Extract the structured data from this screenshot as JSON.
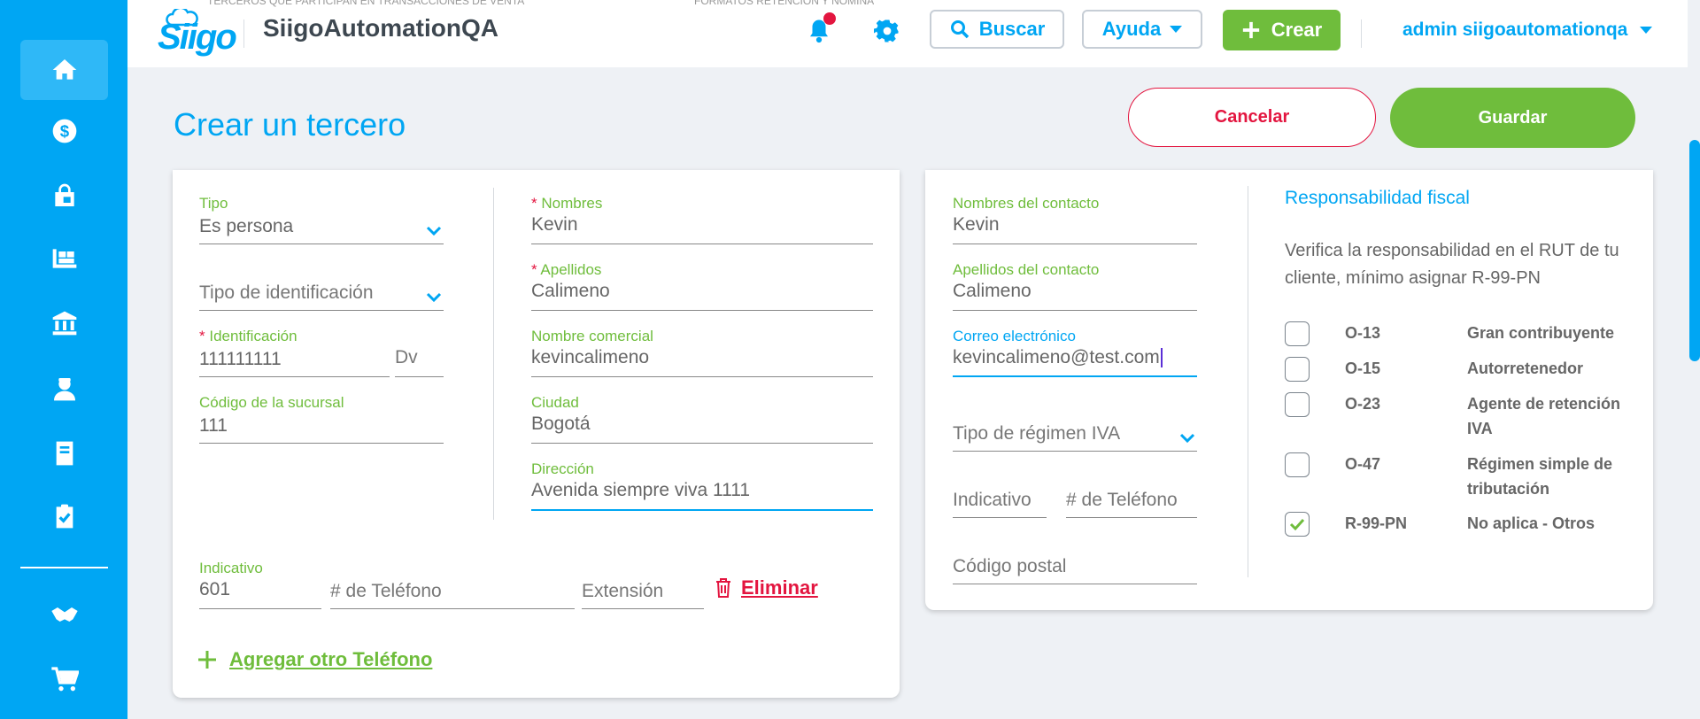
{
  "header": {
    "company_name": "SiigoAutomationQA",
    "logo_text": "Siigo",
    "search_label": "Buscar",
    "help_label": "Ayuda",
    "create_label": "Crear",
    "user_label": "admin siigoautomationqa",
    "ghost_text_1": "TERCEROS QUE PARTICIPAN EN TRANSACCIONES DE VENTA",
    "ghost_text_2": "FORMATOS RETENCIÓN Y NÓMINA"
  },
  "sidebar": {
    "items": [
      "home-icon",
      "dollar-icon",
      "shopping-bag-icon",
      "inventory-icon",
      "bank-icon",
      "employee-icon",
      "book-icon",
      "clipboard-check-icon",
      "handshake-icon",
      "cart-icon"
    ]
  },
  "page": {
    "title": "Crear un tercero",
    "cancel_label": "Cancelar",
    "save_label": "Guardar"
  },
  "left_card": {
    "tipo": {
      "label": "Tipo",
      "value": "Es persona"
    },
    "tipo_identificacion": {
      "placeholder": "Tipo de identificación"
    },
    "identificacion": {
      "required_mark": "*",
      "label": "Identificación",
      "value": "111111111"
    },
    "dv": {
      "placeholder": "Dv"
    },
    "codigo_sucursal": {
      "label": "Código de la sucursal",
      "value": "111"
    },
    "nombres": {
      "required_mark": "*",
      "label": "Nombres",
      "value": "Kevin"
    },
    "apellidos": {
      "required_mark": "*",
      "label": "Apellidos",
      "value": "Calimeno"
    },
    "nombre_comercial": {
      "label": "Nombre comercial",
      "value": "kevincalimeno"
    },
    "ciudad": {
      "label": "Ciudad",
      "value": "Bogotá"
    },
    "direccion": {
      "label": "Dirección",
      "value": "Avenida siempre viva 1111"
    },
    "phone": {
      "indicativo_label": "Indicativo",
      "indicativo_value": "601",
      "telefono_placeholder": "# de Teléfono",
      "extension_placeholder": "Extensión",
      "delete_label": "Eliminar"
    },
    "add_phone_label": "Agregar otro Teléfono"
  },
  "right_card": {
    "nombres_contacto": {
      "label": "Nombres del contacto",
      "value": "Kevin"
    },
    "apellidos_contacto": {
      "label": "Apellidos del contacto",
      "value": "Calimeno"
    },
    "correo": {
      "label": "Correo electrónico",
      "value": "kevincalimeno@test.com"
    },
    "regimen_iva": {
      "placeholder": "Tipo de régimen IVA"
    },
    "indicativo": {
      "placeholder": "Indicativo"
    },
    "telefono": {
      "placeholder": "# de Teléfono"
    },
    "codigo_postal": {
      "placeholder": "Código postal"
    },
    "responsabilidad": {
      "title": "Responsabilidad fiscal",
      "description": "Verifica la responsabilidad en el RUT de tu cliente, mínimo asignar R-99-PN",
      "items": [
        {
          "code": "O-13",
          "name": "Gran contribuyente",
          "checked": false
        },
        {
          "code": "O-15",
          "name": "Autorretenedor",
          "checked": false
        },
        {
          "code": "O-23",
          "name": "Agente de retención IVA",
          "checked": false
        },
        {
          "code": "O-47",
          "name": "Régimen simple de tributación",
          "checked": false
        },
        {
          "code": "R-99-PN",
          "name": "No aplica - Otros",
          "checked": true
        }
      ]
    }
  },
  "colors": {
    "primary": "#00a6f3",
    "success": "#6fbd3c",
    "danger": "#e3153f"
  }
}
